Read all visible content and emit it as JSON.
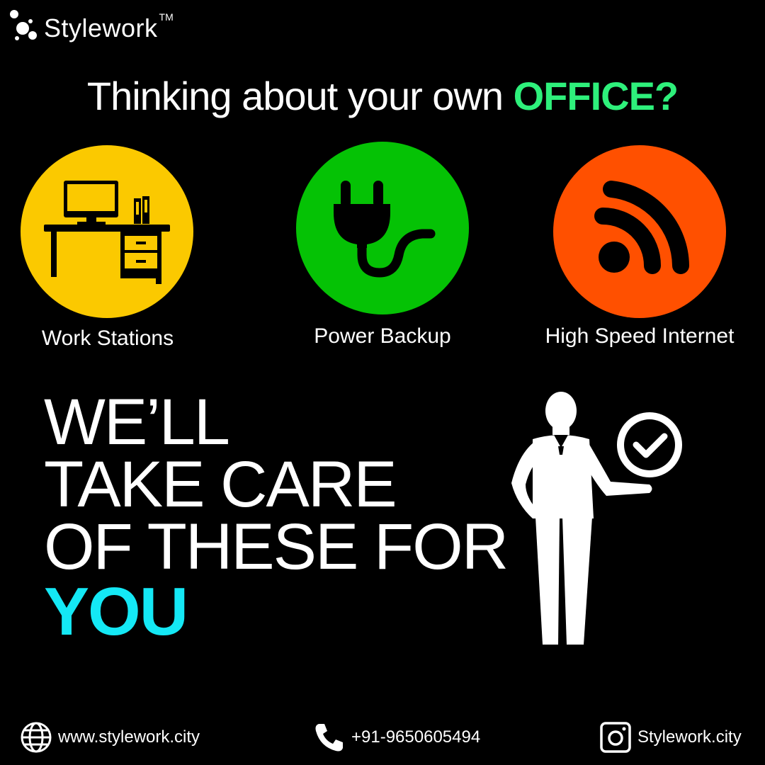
{
  "brand": {
    "name": "Stylework",
    "trademark": "TM"
  },
  "headline": {
    "prefix": "Thinking about your own ",
    "accent": "OFFICE?"
  },
  "colors": {
    "accent_green": "#2ef07b",
    "accent_cyan": "#14e8f5",
    "workstation_circle": "#fbc900",
    "power_circle": "#05c205",
    "internet_circle": "#ff5000"
  },
  "features": [
    {
      "label": "Work Stations",
      "icon": "desk-computer-icon"
    },
    {
      "label": "Power Backup",
      "icon": "power-plug-icon"
    },
    {
      "label": "High Speed Internet",
      "icon": "wifi-signal-icon"
    }
  ],
  "tagline": {
    "line1": "WE’LL",
    "line2": "TAKE CARE",
    "line3": "OF THESE FOR",
    "line4": "YOU"
  },
  "footer": {
    "website": "www.stylework.city",
    "phone": "+91-9650605494",
    "instagram": "Stylework.city"
  }
}
